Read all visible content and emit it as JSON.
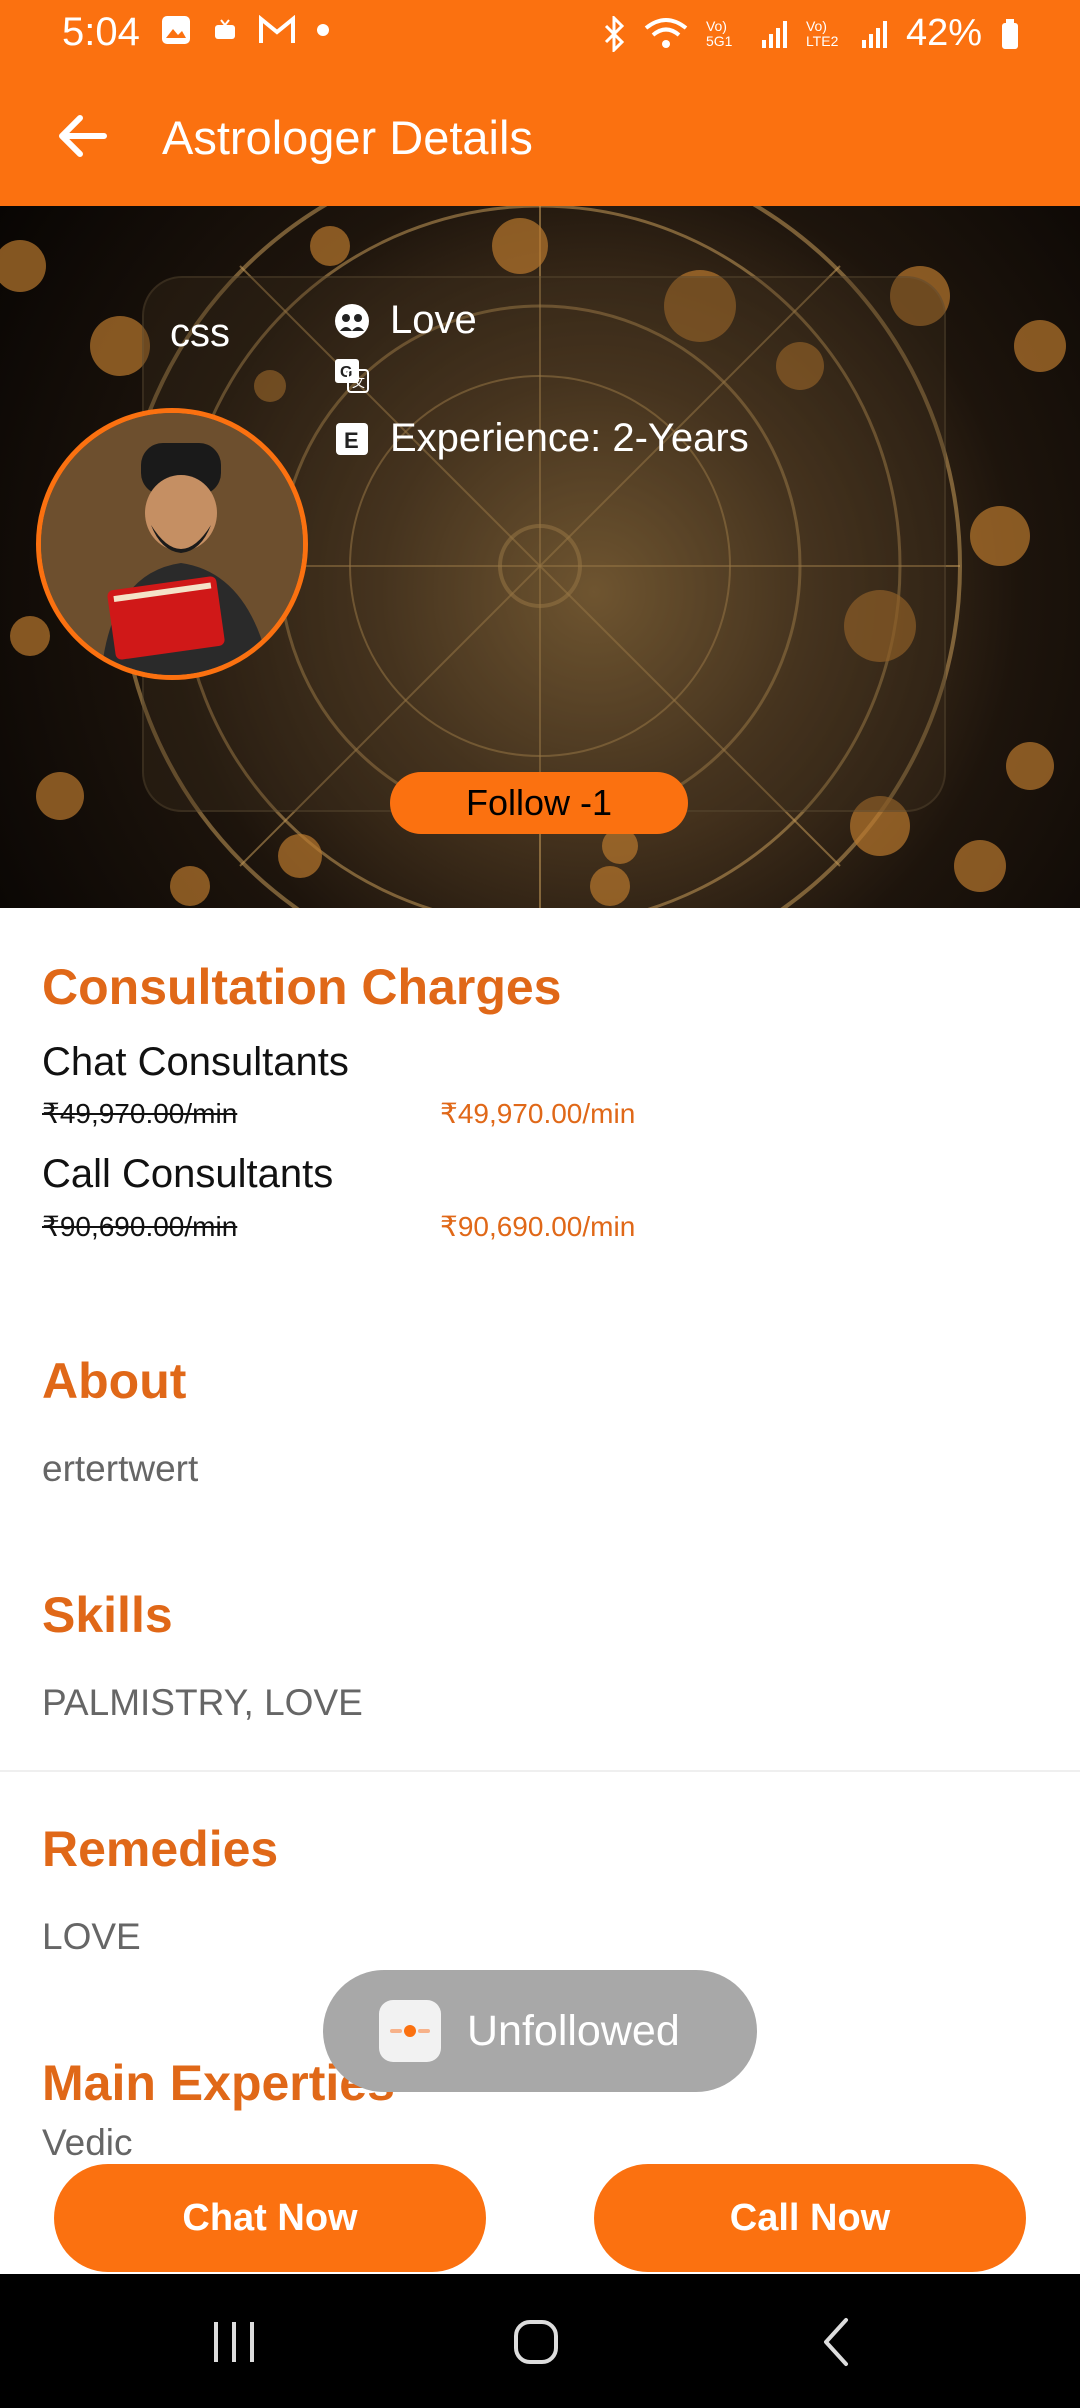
{
  "status_bar": {
    "time": "5:04",
    "network_1": "Vo) 5G1",
    "network_2": "Vo) LTE2",
    "battery": "42%"
  },
  "app_bar": {
    "title": "Astrologer Details"
  },
  "profile": {
    "name": "css",
    "specialty": "Love",
    "languages": "",
    "experience": "Experience: 2-Years",
    "follow_label": "Follow -1"
  },
  "consultation": {
    "title": "Consultation  Charges",
    "chat": {
      "label": "Chat Consultants",
      "old_price": "₹49,970.00/min",
      "price": "₹49,970.00/min"
    },
    "call": {
      "label": "Call Consultants",
      "old_price": "₹90,690.00/min",
      "price": "₹90,690.00/min"
    }
  },
  "about": {
    "title": "About",
    "text": "ertertwert"
  },
  "skills": {
    "title": "Skills",
    "text": "PALMISTRY, LOVE"
  },
  "remedies": {
    "title": "Remedies",
    "text": "LOVE"
  },
  "experties": {
    "title": "Main Experties",
    "text": "Vedic"
  },
  "toast": {
    "message": "Unfollowed"
  },
  "actions": {
    "chat_label": "Chat Now",
    "call_label": "Call Now"
  },
  "colors": {
    "accent": "#fb7110",
    "heading": "#e06818",
    "toast": "#a8a8a8"
  }
}
